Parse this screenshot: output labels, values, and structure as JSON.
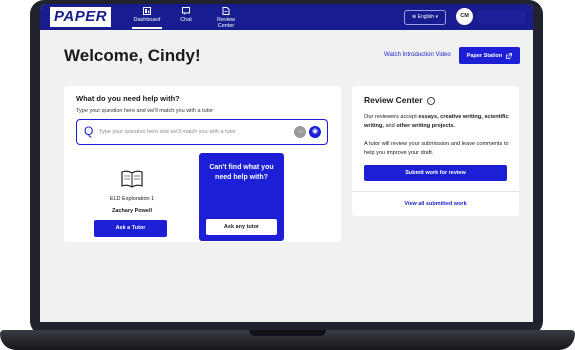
{
  "nav": {
    "logo": "PAPER",
    "items": [
      {
        "label": "Dashboard",
        "icon": "dashboard-icon"
      },
      {
        "label": "Chat",
        "icon": "chat-icon"
      },
      {
        "label": "Review Center",
        "icon": "document-icon"
      }
    ],
    "language": "English",
    "user_initials": "CM"
  },
  "header": {
    "welcome": "Welcome, Cindy!",
    "watch_link": "Watch Introduction Video",
    "station_button": "Paper Station"
  },
  "help": {
    "title": "What do you need help with?",
    "subtitle": "Type your question here and we'll match you with a tutor",
    "search_placeholder": "Type your question here and we'll match you with a tutor",
    "tutor_card": {
      "subject": "ELD Exploration 1",
      "tutor_name": "Zachary Powell",
      "button": "Ask a Tutor"
    },
    "cant_find": {
      "text": "Can't find what you need help with?",
      "button": "Ask any tutor"
    }
  },
  "review_center": {
    "title": "Review Center",
    "p1_prefix": "Our reviewers accept ",
    "p1_bold1": "essays, creative writing, scientific writing,",
    "p1_mid": " and ",
    "p1_bold2": "other writing projects.",
    "p2": "A tutor will review your submission and leave comments to help you improve your draft.",
    "submit_button": "Submit work for review",
    "view_all": "View all submitted work"
  },
  "colors": {
    "nav_bg": "#171c8f",
    "primary": "#1c1fd6",
    "link": "#1e24c9",
    "page_bg": "#f1f1f2"
  }
}
